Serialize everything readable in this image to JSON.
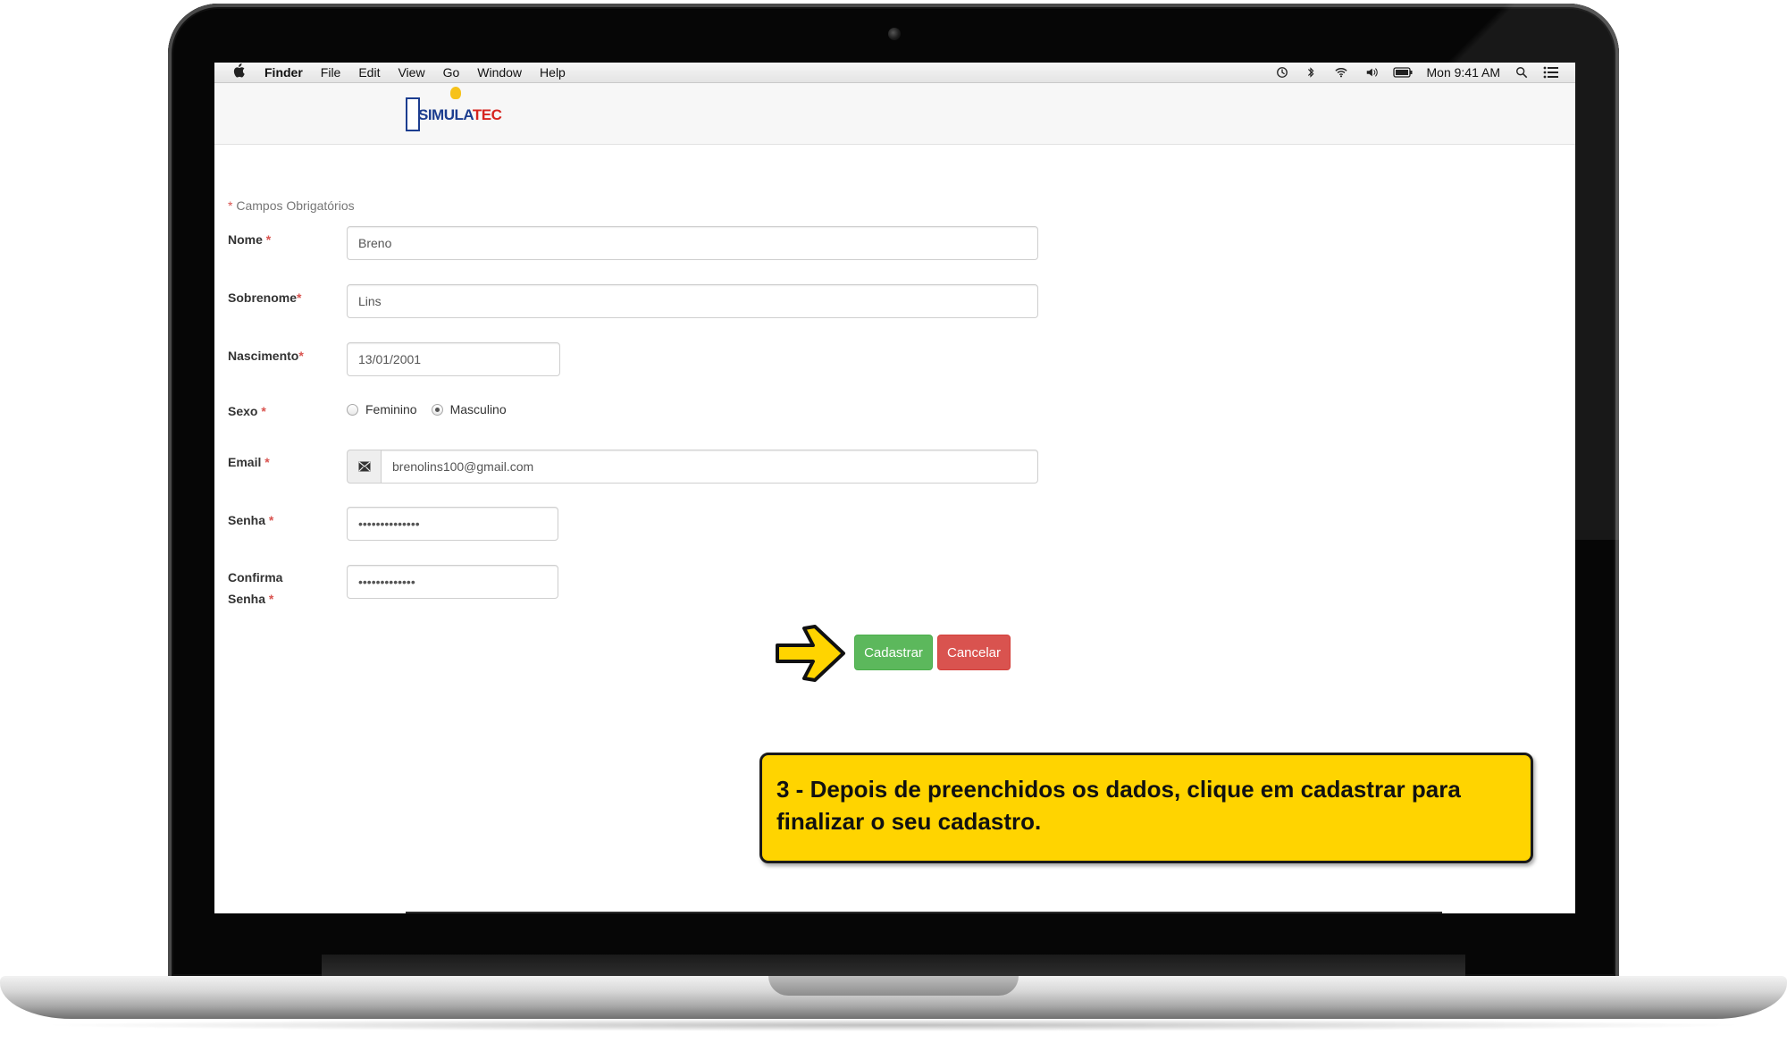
{
  "menubar": {
    "apple": "",
    "app": "Finder",
    "menus": [
      "File",
      "Edit",
      "View",
      "Go",
      "Window",
      "Help"
    ],
    "clock": "Mon 9:41 AM",
    "status_icons": [
      "time-machine-icon",
      "bluetooth-icon",
      "wifi-icon",
      "volume-icon",
      "battery-icon",
      "spotlight-icon",
      "notification-center-icon"
    ]
  },
  "logo": {
    "text_main": "SIMULA",
    "text_accent": "TEC"
  },
  "form": {
    "required_marker": "*",
    "required_note": "Campos Obrigatórios",
    "fields": {
      "nome": {
        "label": "Nome",
        "value": "Breno"
      },
      "sobrenome": {
        "label": "Sobrenome",
        "value": "Lins"
      },
      "nascimento": {
        "label": "Nascimento",
        "value": "13/01/2001"
      },
      "sexo": {
        "label": "Sexo",
        "options": [
          "Feminino",
          "Masculino"
        ],
        "selected": "Masculino"
      },
      "email": {
        "label": "Email",
        "value": "brenolins100@gmail.com",
        "icon": "envelope-icon"
      },
      "senha": {
        "label": "Senha",
        "value": "••••••••••••••"
      },
      "confirma": {
        "label_line1": "Confirma",
        "label_line2": "Senha",
        "value": "•••••••••••••"
      }
    },
    "buttons": {
      "submit": "Cadastrar",
      "cancel": "Cancelar"
    }
  },
  "callout": {
    "text": "3 - Depois de preenchidos os dados, clique em cadastrar para finalizar o seu cadastro."
  },
  "colors": {
    "success": "#5cb85c",
    "danger": "#d9534f",
    "callout_bg": "#ffd400",
    "brand_blue": "#1c3d8f",
    "brand_red": "#d6241f"
  }
}
